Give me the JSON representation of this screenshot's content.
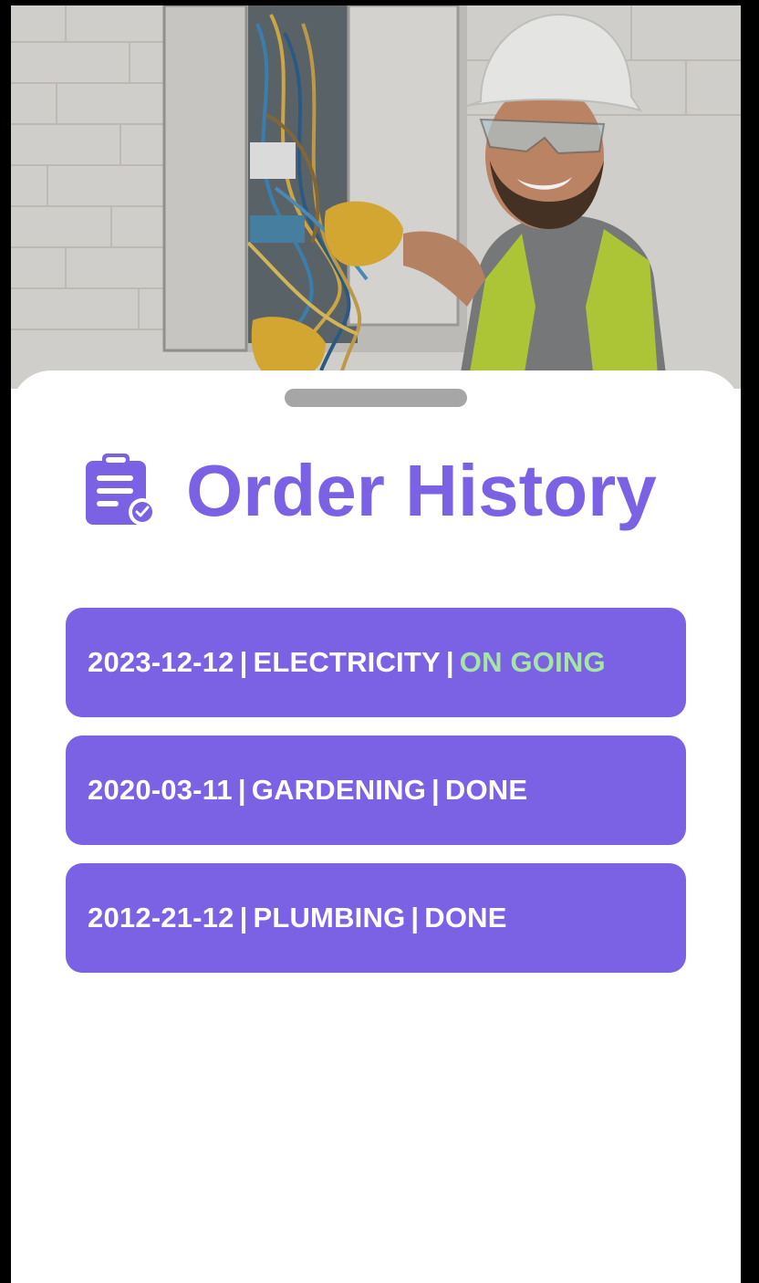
{
  "hero": {
    "image": "electrician-photo",
    "description_icon": "worker-with-helmet-icon"
  },
  "header": {
    "icon": "clipboard-check-icon",
    "title": "Order History"
  },
  "colors": {
    "accent": "#7b61e3",
    "ongoing": "#a6e6a3",
    "card_text": "#ffffff"
  },
  "orders": [
    {
      "date": "2023-12-12",
      "service": "ELECTRICITY",
      "status": "ON GOING",
      "status_type": "ongoing"
    },
    {
      "date": "2020-03-11",
      "service": "GARDENING",
      "status": "DONE",
      "status_type": "done"
    },
    {
      "date": "2012-21-12",
      "service": "PLUMBING",
      "status": "DONE",
      "status_type": "done"
    }
  ],
  "separator": "|"
}
